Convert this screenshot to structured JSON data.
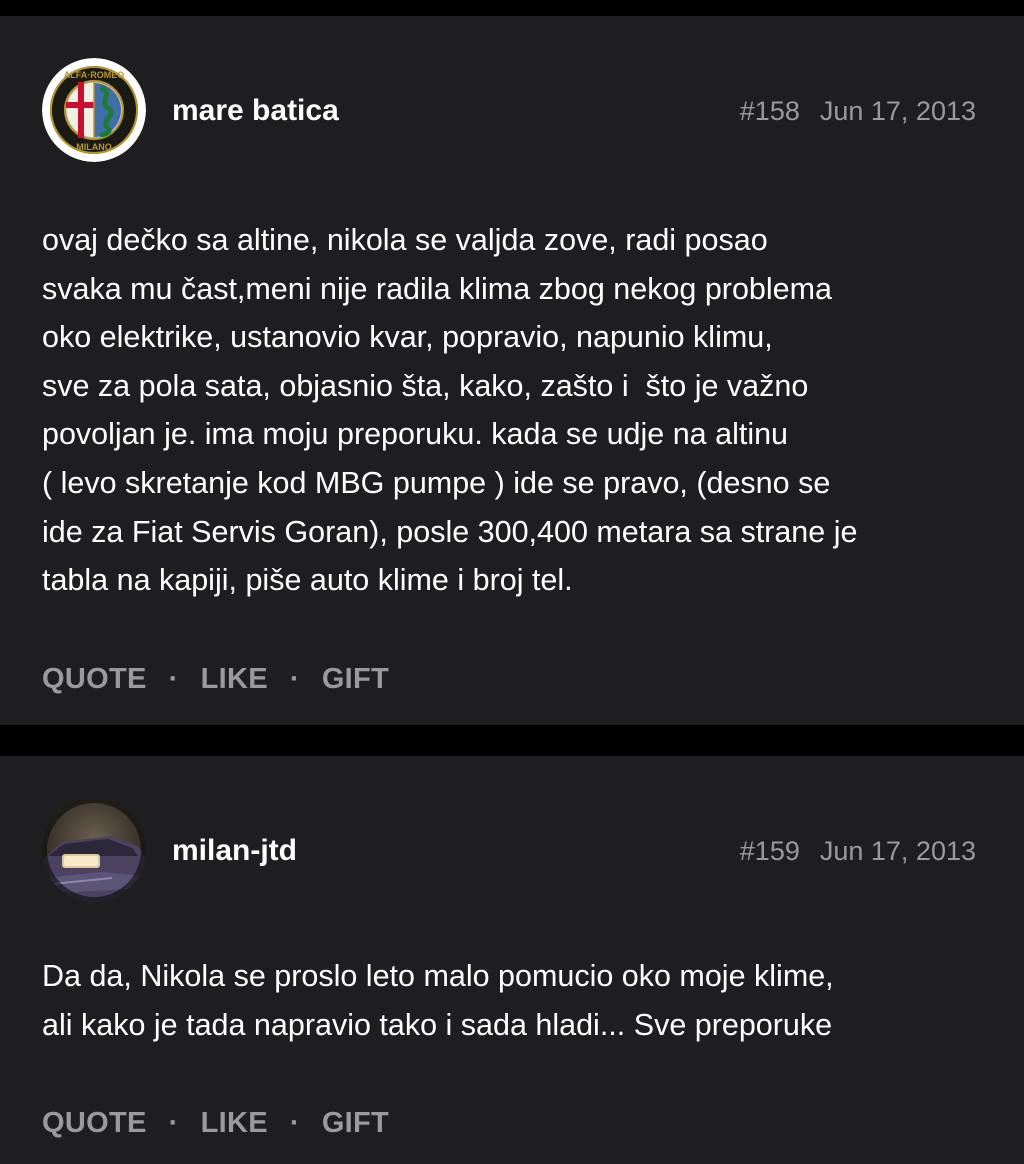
{
  "posts": [
    {
      "username": "mare batica",
      "number": "#158",
      "date": "Jun 17, 2013",
      "avatar_icon": "alfa-romeo-badge-avatar",
      "body_lines": [
        "ovaj dečko sa altine, nikola se valjda zove, radi posao",
        "svaka mu čast,meni nije radila klima zbog nekog problema",
        "oko elektrike, ustanovio kvar, popravio, napunio klimu,",
        "sve za pola sata, objasnio šta, kako, zašto i  što je važno",
        "povoljan je. ima moju preporuku. kada se udje na altinu",
        "( levo skretanje kod MBG pumpe ) ide se pravo, (desno se",
        "ide za Fiat Servis Goran), posle 300,400 metara sa strane je",
        "tabla na kapiji, piše auto klime i broj tel."
      ],
      "actions": {
        "quote": "QUOTE",
        "like": "LIKE",
        "gift": "GIFT",
        "separator": "·"
      }
    },
    {
      "username": "milan-jtd",
      "number": "#159",
      "date": "Jun 17, 2013",
      "avatar_icon": "car-photo-avatar",
      "body_lines": [
        "Da da, Nikola se proslo leto malo pomucio oko moje klime,",
        "ali kako je tada napravio tako i sada hladi... Sve preporuke"
      ],
      "actions": {
        "quote": "QUOTE",
        "like": "LIKE",
        "gift": "GIFT",
        "separator": "·"
      }
    }
  ],
  "colors": {
    "page_background": "#000000",
    "post_background": "#1e1e20",
    "text_primary": "#ffffff",
    "text_secondary": "#9a9a9e",
    "alfa_red": "#c8102e",
    "alfa_green": "#1f7a3a",
    "alfa_gold": "#b8962e"
  }
}
